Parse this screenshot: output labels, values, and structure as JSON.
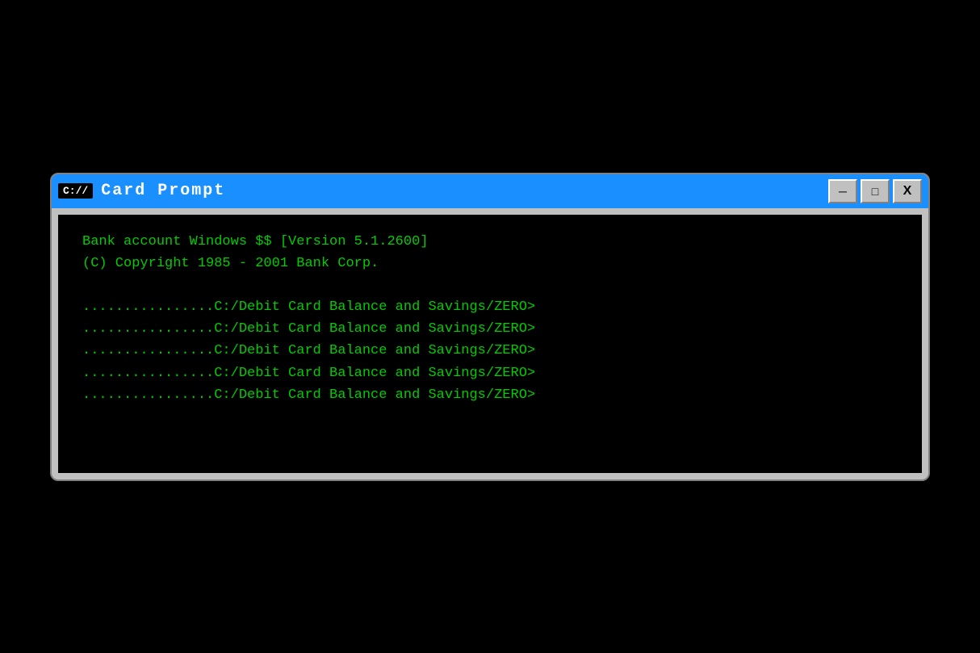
{
  "window": {
    "title": "Card  Prompt",
    "icon_label": "C://",
    "minimize_label": "─",
    "maximize_label": "□",
    "close_label": "X"
  },
  "terminal": {
    "line1": "Bank account Windows $$ [Version 5.1.2600]",
    "line2": "(C) Copyright 1985 - 2001 Bank Corp.",
    "prompt_line": "................C:/Debit Card Balance and Savings/ZERO>",
    "prompt_repeat_count": 5
  }
}
